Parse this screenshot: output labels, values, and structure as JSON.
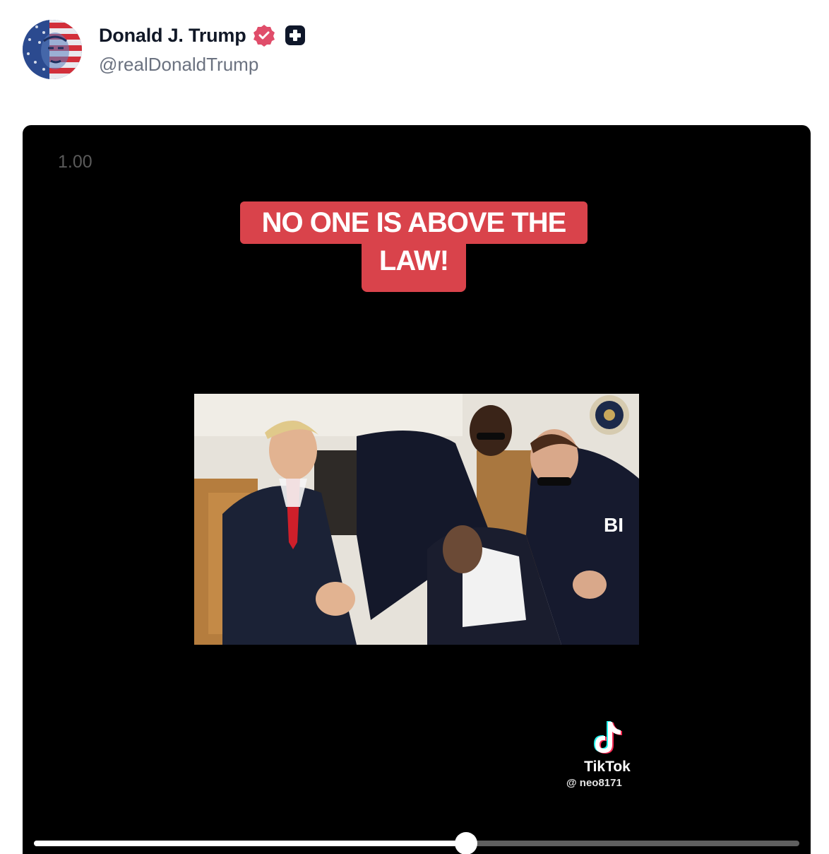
{
  "author": {
    "display_name": "Donald J. Trump",
    "handle": "@realDonaldTrump",
    "avatar_icon": "flag-portrait-avatar",
    "verified_icon": "verified-badge-icon",
    "verified_color": "#e04d6a",
    "extra_badge_icon": "plus-badge-icon"
  },
  "video": {
    "speed_label": "1.00",
    "caption_line1": "NO ONE IS ABOVE THE",
    "caption_line2": "LAW!",
    "caption_color": "#d9434b",
    "watermark_brand": "TikTok",
    "watermark_user": "@ neo8171",
    "image_overlay_text": "BI",
    "progress_fraction": 0.565
  }
}
